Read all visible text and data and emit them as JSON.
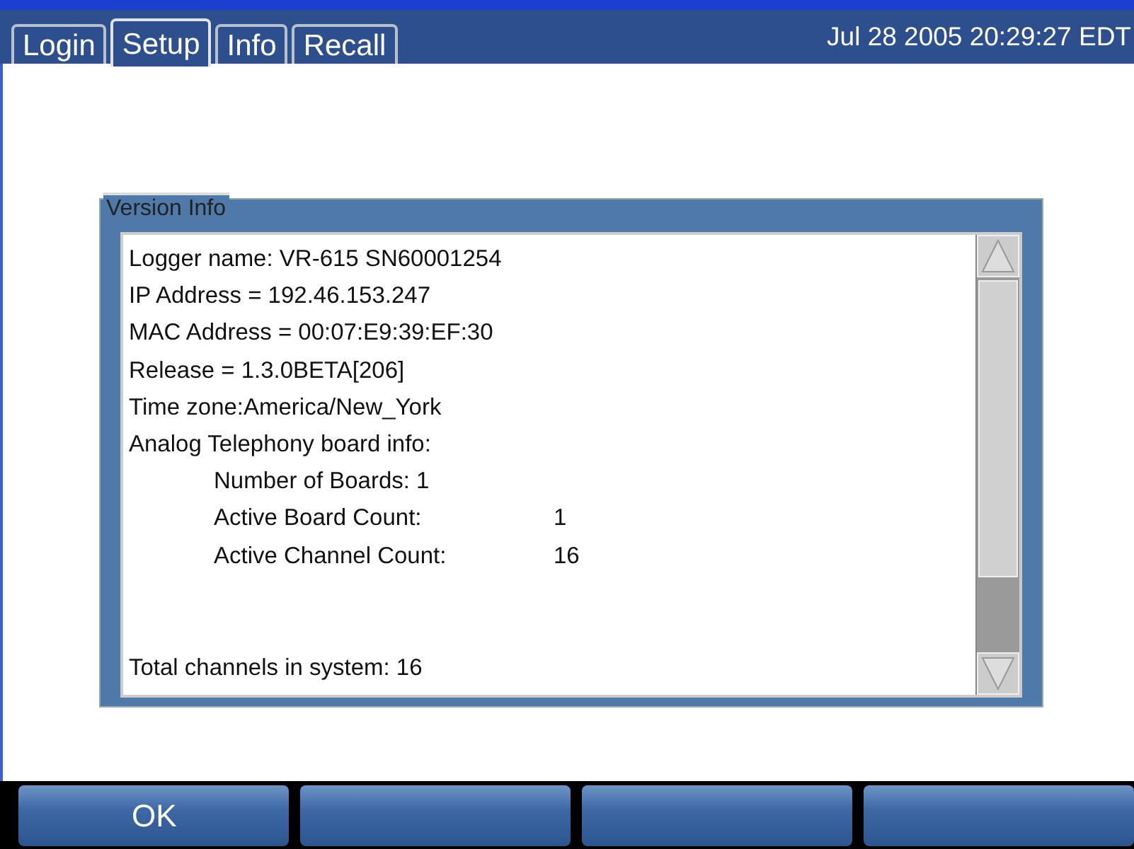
{
  "tabs": [
    {
      "label": "Login",
      "selected": false
    },
    {
      "label": "Setup",
      "selected": true
    },
    {
      "label": "Info",
      "selected": false
    },
    {
      "label": "Recall",
      "selected": false
    }
  ],
  "clock": "Jul 28 2005 20:29:27 EDT",
  "panel": {
    "title": "Version Info",
    "lines": [
      {
        "kind": "line",
        "text": "Logger name: VR-615 SN60001254"
      },
      {
        "kind": "line",
        "text": "IP Address = 192.46.153.247"
      },
      {
        "kind": "line",
        "text": "MAC Address = 00:07:E9:39:EF:30"
      },
      {
        "kind": "line",
        "text": "Release = 1.3.0BETA[206]"
      },
      {
        "kind": "line",
        "text": "Time zone:America/New_York"
      },
      {
        "kind": "line",
        "text": "Analog Telephony board info:"
      },
      {
        "kind": "indent",
        "text": "Number of Boards: 1"
      },
      {
        "kind": "pair",
        "text": "Active Board Count:",
        "value": "1"
      },
      {
        "kind": "pair",
        "text": "Active Channel Count:",
        "value": "16"
      },
      {
        "kind": "footer",
        "text": "Total channels in system: 16"
      }
    ]
  },
  "buttons": [
    {
      "kind": "labeled",
      "label": "OK"
    },
    {
      "kind": "blank"
    },
    {
      "kind": "blank"
    },
    {
      "kind": "blank"
    }
  ]
}
